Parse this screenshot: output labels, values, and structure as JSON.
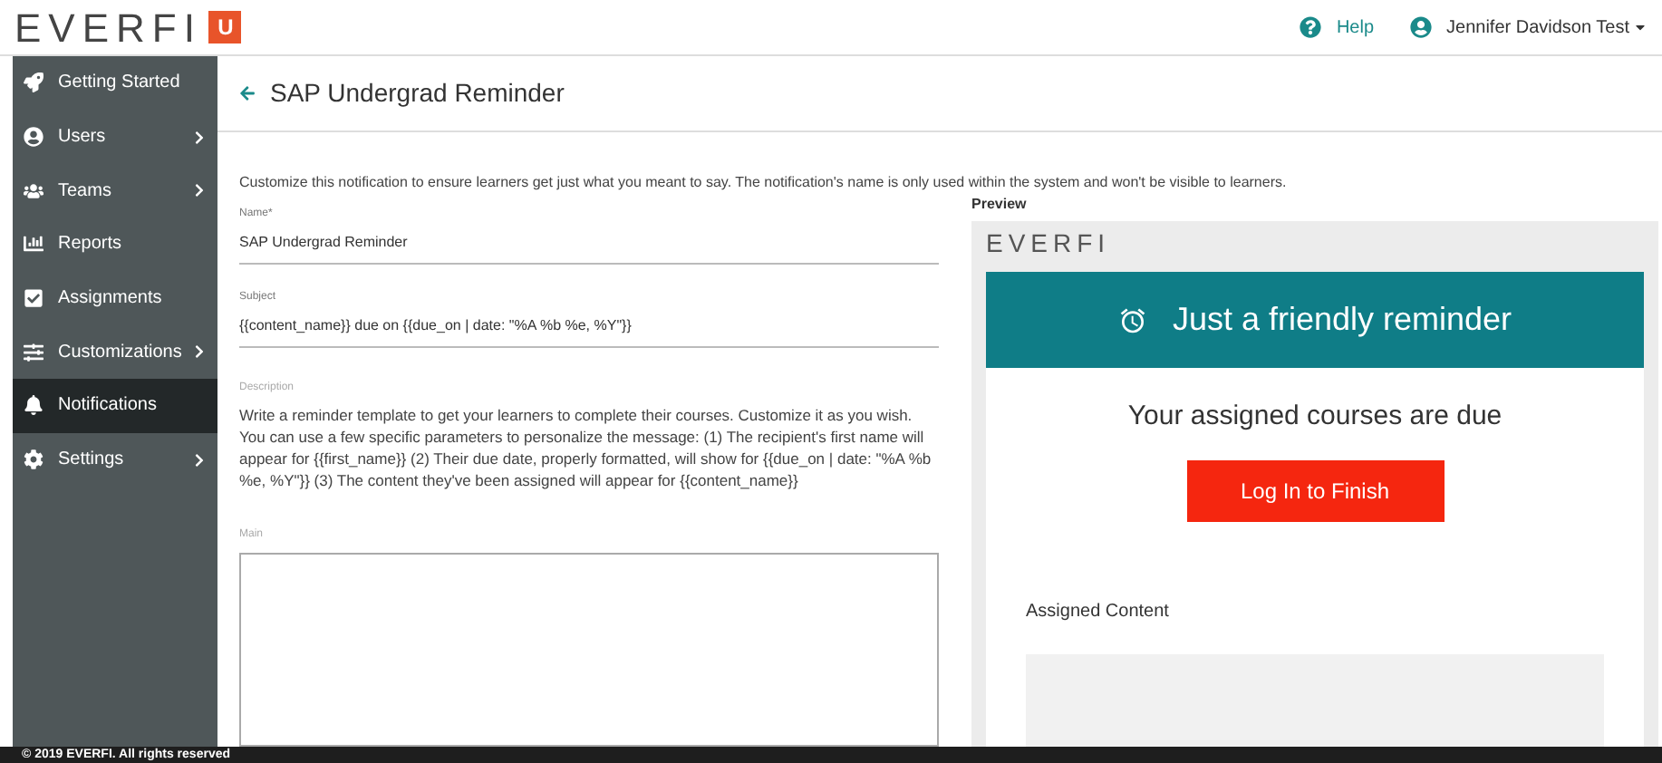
{
  "header": {
    "logo": "EVERFI",
    "logo_badge": "U",
    "help": "Help",
    "user": "Jennifer Davidson Test"
  },
  "sidebar": {
    "items": [
      {
        "label": "Getting Started",
        "has_submenu": false,
        "selected": false
      },
      {
        "label": "Users",
        "has_submenu": true,
        "selected": false
      },
      {
        "label": "Teams",
        "has_submenu": true,
        "selected": false
      },
      {
        "label": "Reports",
        "has_submenu": false,
        "selected": false
      },
      {
        "label": "Assignments",
        "has_submenu": false,
        "selected": false
      },
      {
        "label": "Customizations",
        "has_submenu": true,
        "selected": false
      },
      {
        "label": "Notifications",
        "has_submenu": false,
        "selected": true
      },
      {
        "label": "Settings",
        "has_submenu": true,
        "selected": false
      }
    ]
  },
  "page": {
    "title": "SAP Undergrad Reminder",
    "intro": "Customize this notification to ensure learners get just what you meant to say. The notification's name is only used within the system and won't be visible to learners.",
    "fields": [
      {
        "label": "Name*",
        "value": "SAP Undergrad Reminder"
      },
      {
        "label": "Subject",
        "value": "{{content_name}} due on {{due_on | date: \"%A %b %e, %Y\"}}"
      }
    ],
    "description_label": "Description",
    "description": "Write a reminder template to get your learners to complete their courses. Customize it as you wish. You can use a few specific parameters to personalize the message: (1) The recipient's first name will appear for {{first_name}} (2) Their due date, properly formatted, will show for {{due_on | date: \"%A %b %e, %Y\"}} (3) The content they've been assigned will appear for {{content_name}}",
    "main_label": "Main"
  },
  "preview": {
    "label": "Preview",
    "logo": "EVERFI",
    "banner": "Just a friendly reminder",
    "heading": "Your assigned courses are due",
    "button": "Log In to Finish",
    "section": "Assigned Content"
  },
  "footer": "© 2019 EVERFI. All rights reserved"
}
